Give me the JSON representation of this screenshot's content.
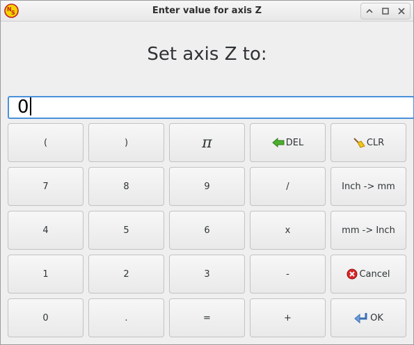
{
  "window": {
    "title": "Enter value for axis Z"
  },
  "prompt": "Set axis Z to:",
  "value_field": {
    "value": "0"
  },
  "keys": {
    "open_paren": "(",
    "close_paren": ")",
    "pi": "π",
    "del": "DEL",
    "clr": "CLR",
    "seven": "7",
    "eight": "8",
    "nine": "9",
    "divide": "/",
    "inch_to_mm": "Inch -> mm",
    "four": "4",
    "five": "5",
    "six": "6",
    "multiply": "x",
    "mm_to_inch": "mm -> Inch",
    "one": "1",
    "two": "2",
    "three": "3",
    "minus": "-",
    "cancel": "Cancel",
    "zero": "0",
    "dot": ".",
    "equals": "=",
    "plus": "+",
    "ok": "OK"
  },
  "icons": {
    "app_logo": "linuxcnc-logo-icon",
    "restore": "restore-icon",
    "maximize": "maximize-icon",
    "close": "close-icon",
    "del": "arrow-left-icon",
    "clr": "broom-icon",
    "cancel": "cancel-icon",
    "ok": "enter-icon"
  },
  "colors": {
    "focus_border": "#4a90d9",
    "del_arrow": "#4caf2e",
    "cancel_red": "#d9262a",
    "logo_yellow": "#f5d300"
  }
}
